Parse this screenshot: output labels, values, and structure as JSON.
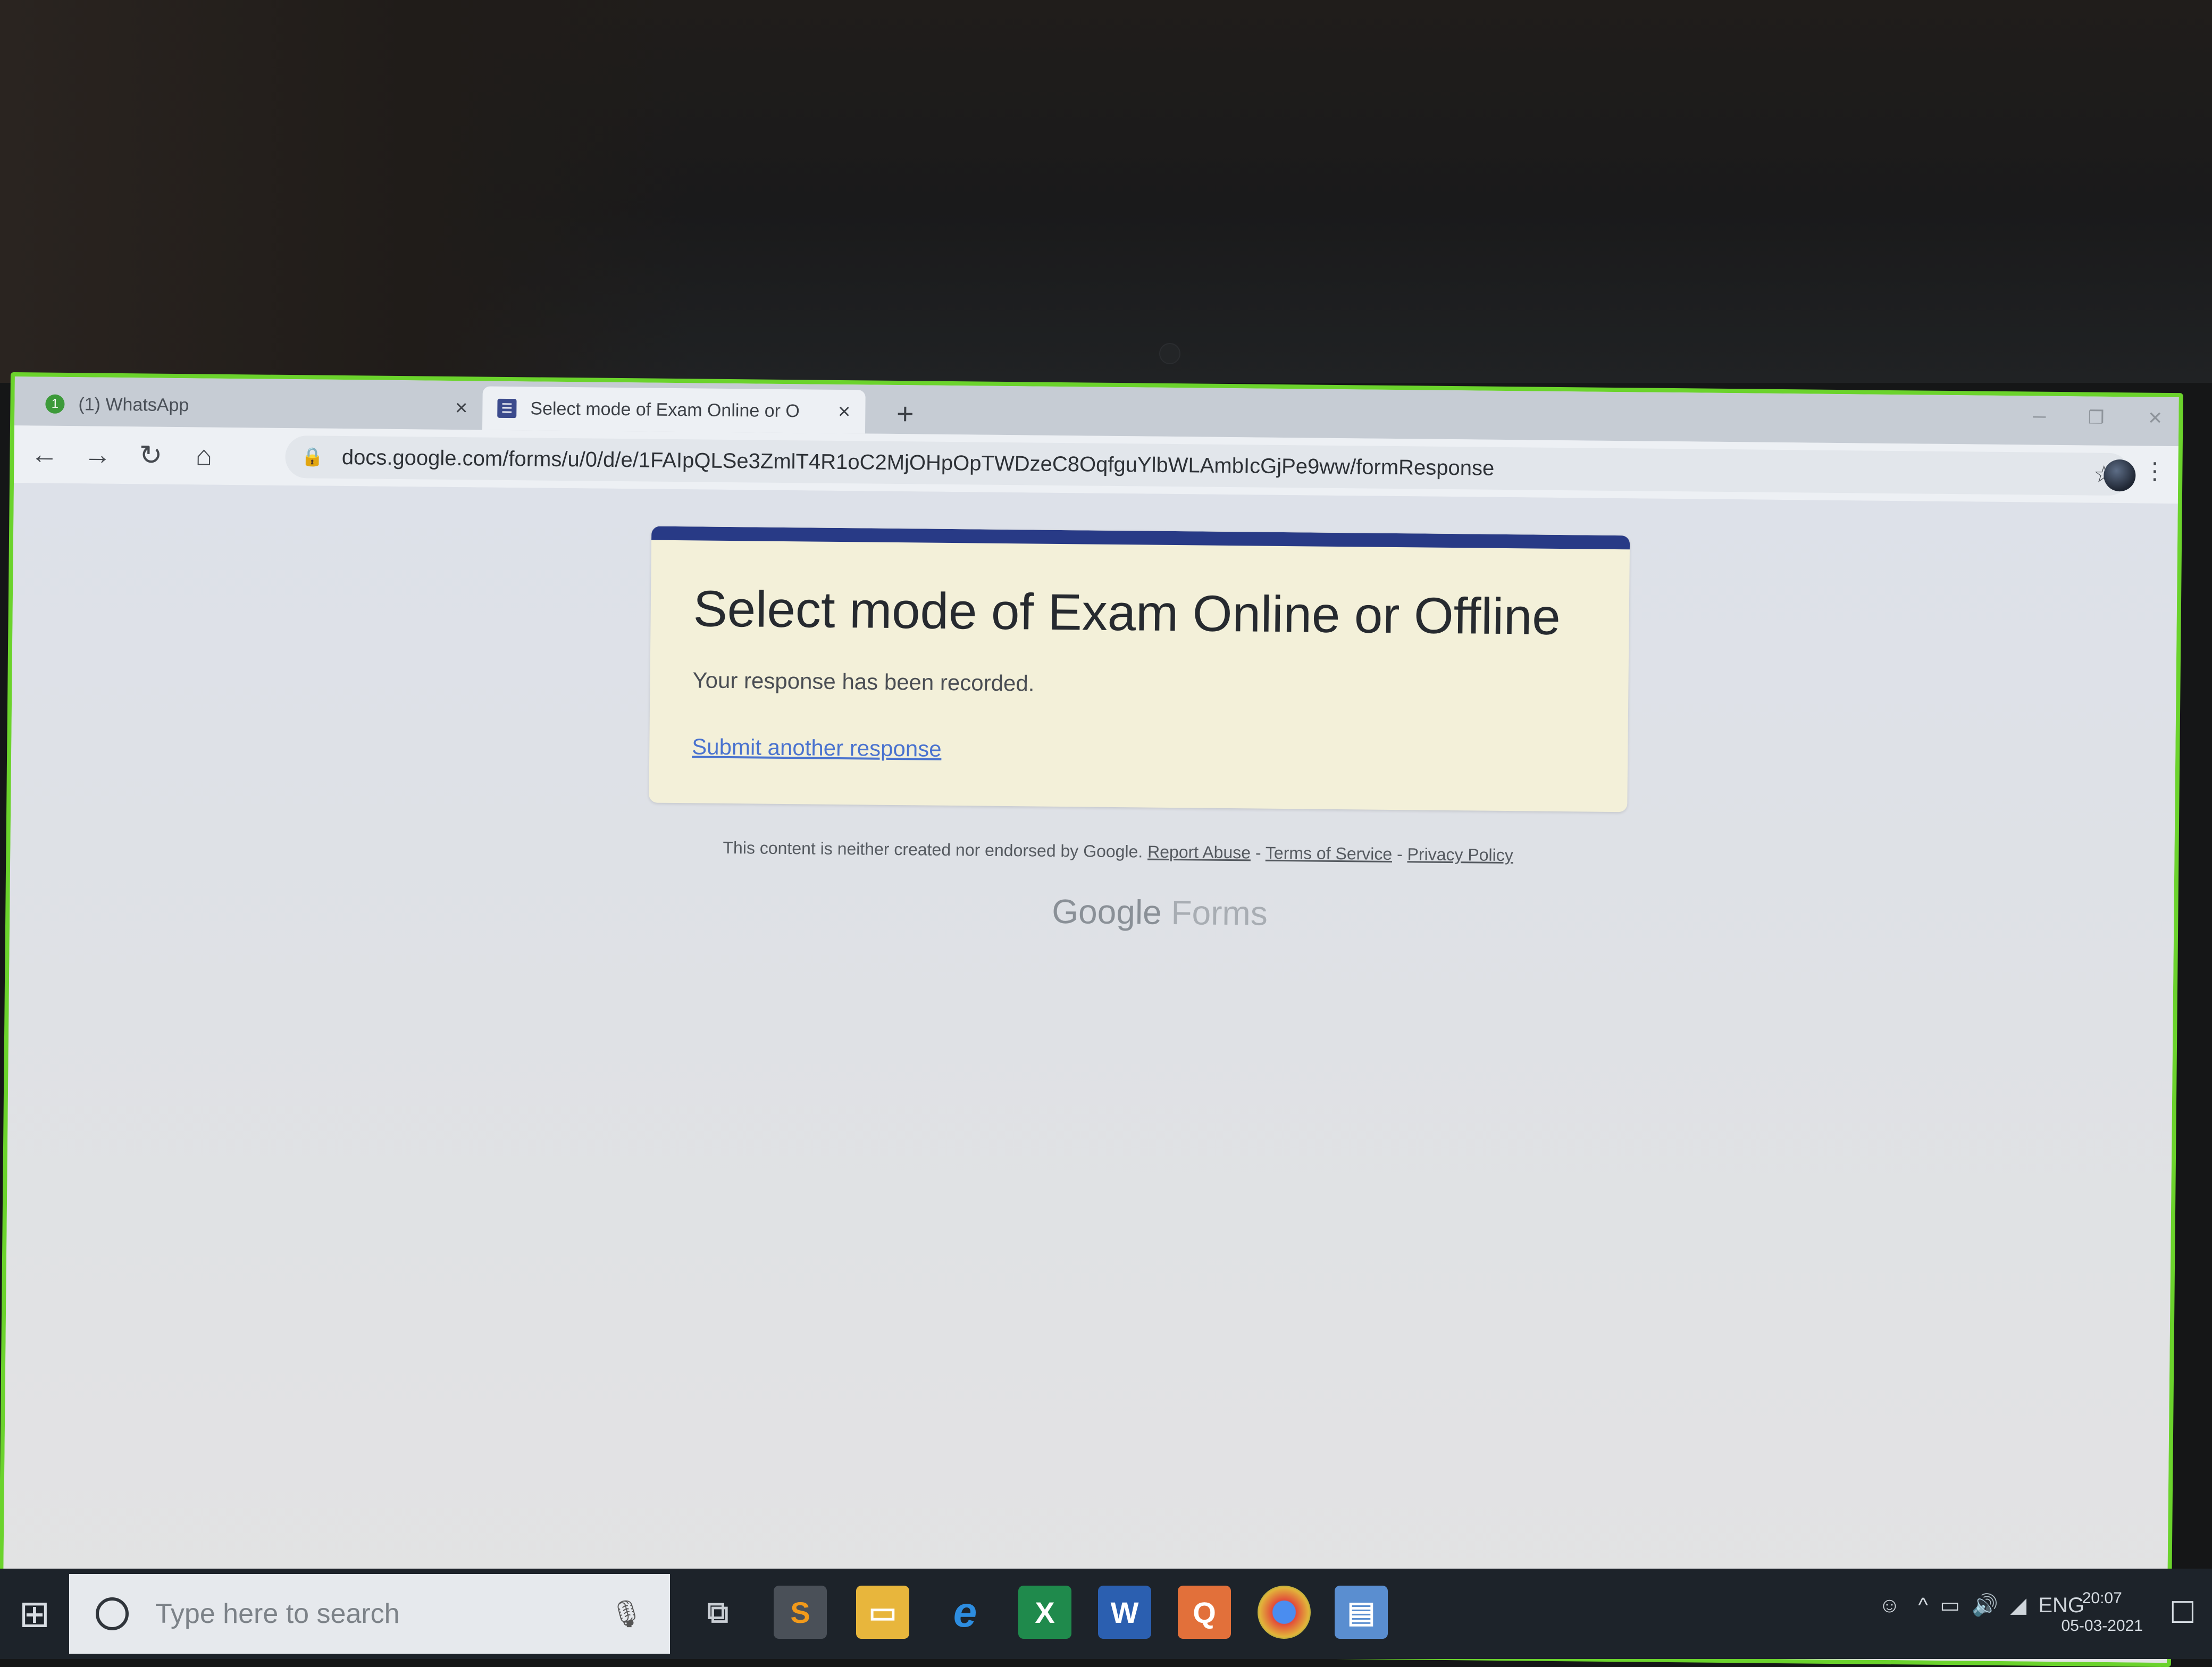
{
  "browser": {
    "tabs": [
      {
        "label": "(1) WhatsApp",
        "icon": "whatsapp-icon",
        "active": false
      },
      {
        "label": "Select mode of Exam Online or O",
        "icon": "forms-icon",
        "active": true
      }
    ],
    "new_tab_label": "+",
    "close_glyph": "×",
    "url": "docs.google.com/forms/u/0/d/e/1FAIpQLSe3ZmlT4R1oC2MjOHpOpTWDzeC8OqfguYlbWLAmbIcGjPe9ww/formResponse"
  },
  "form": {
    "title": "Select mode of Exam Online or Offline",
    "message": "Your response has been recorded.",
    "link": "Submit another response",
    "accent_color": "#283a86"
  },
  "footer": {
    "disclaimer": "This content is neither created nor endorsed by Google.",
    "report_abuse": "Report Abuse",
    "terms": "Terms of Service",
    "privacy": "Privacy Policy",
    "separator": " - ",
    "brand_google": "Google",
    "brand_forms": "Forms"
  },
  "taskbar": {
    "search_placeholder": "Type here to search",
    "pinned_apps": [
      "task-view",
      "sublime-text",
      "file-explorer",
      "edge",
      "excel",
      "word",
      "quick-heal",
      "chrome",
      "network-app"
    ],
    "language": "ENG",
    "time": "20:07",
    "date": "05-03-2021"
  }
}
